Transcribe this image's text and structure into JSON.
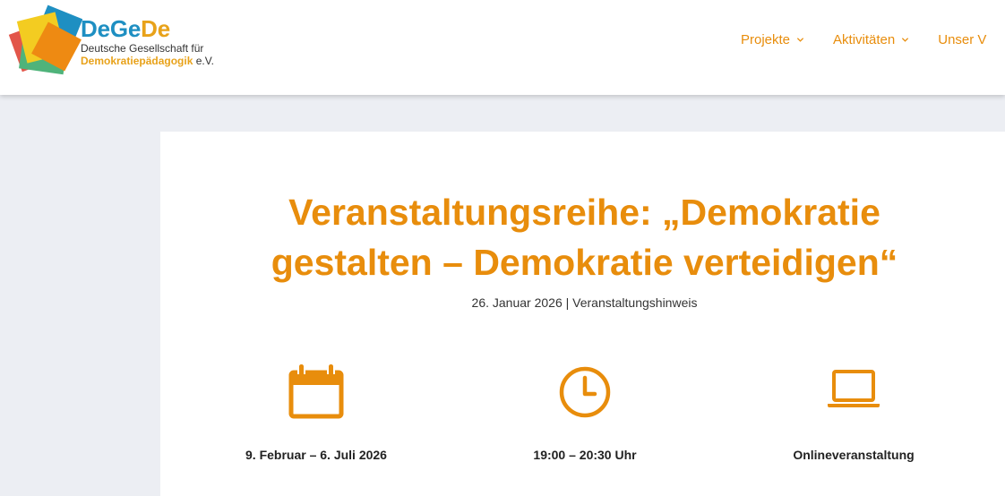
{
  "brand": {
    "name_part1": "DeGe",
    "name_part2": "De",
    "line1": "Deutsche Gesellschaft für",
    "line2_accent": "Demokratiepädagogik",
    "line2_rest": " e.V.",
    "colors": {
      "blue": "#1e8fc2",
      "orange": "#e8a21a",
      "red": "#e2564a",
      "green": "#4fb37a",
      "yellow": "#f3cc21",
      "dark_orange": "#ee8a12"
    }
  },
  "nav": {
    "items": [
      {
        "label": "Projekte",
        "icon": "chevron-down-icon"
      },
      {
        "label": "Aktivitäten",
        "icon": "chevron-down-icon"
      },
      {
        "label": "Unser V"
      }
    ],
    "color": "#e88d0c"
  },
  "article": {
    "title_line1": "Veranstaltungsreihe: „Demokratie",
    "title_line2": "gestalten – Demokratie verteidigen“",
    "date": "26. Januar 2026",
    "separator": " | ",
    "category": "Veranstaltungshinweis",
    "accent_color": "#e88d0c"
  },
  "info": {
    "date_range": {
      "icon": "calendar-icon",
      "label": "9. Februar – 6. Juli 2026"
    },
    "time": {
      "icon": "clock-icon",
      "label": "19:00 – 20:30 Uhr"
    },
    "format": {
      "icon": "laptop-icon",
      "label": "Onlineveranstaltung"
    }
  }
}
